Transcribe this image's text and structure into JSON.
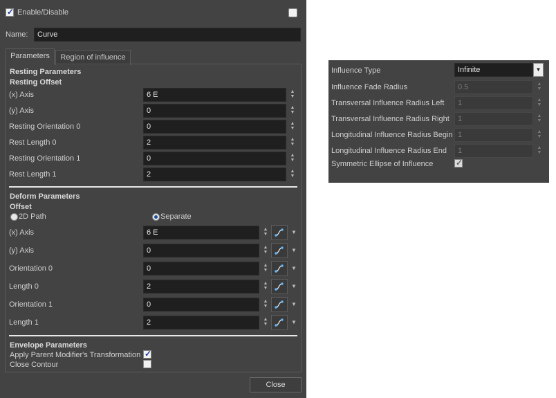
{
  "dialog": {
    "enable_label": "Enable/Disable",
    "enable_checked": true,
    "name_label": "Name:",
    "name_value": "Curve",
    "tabs": [
      {
        "label": "Parameters",
        "active": true
      },
      {
        "label": "Region of influence",
        "active": false
      }
    ],
    "resting": {
      "section_title": "Resting Parameters",
      "subsection_title": "Resting Offset",
      "rows": [
        {
          "label": "(x) Axis",
          "value": "6 E"
        },
        {
          "label": "(y) Axis",
          "value": "0"
        },
        {
          "label": "Resting Orientation 0",
          "value": "0"
        },
        {
          "label": "Rest Length 0",
          "value": "2"
        },
        {
          "label": "Resting Orientation 1",
          "value": "0"
        },
        {
          "label": "Rest Length 1",
          "value": "2"
        }
      ]
    },
    "deform": {
      "section_title": "Deform Parameters",
      "subsection_title": "Offset",
      "radio_2d_path": "2D Path",
      "radio_separate": "Separate",
      "selected_radio": "Separate",
      "rows": [
        {
          "label": "(x) Axis",
          "value": "6 E"
        },
        {
          "label": "(y) Axis",
          "value": "0"
        },
        {
          "label": "Orientation 0",
          "value": "0"
        },
        {
          "label": "Length 0",
          "value": "2"
        },
        {
          "label": "Orientation 1",
          "value": "0"
        },
        {
          "label": "Length 1",
          "value": "2"
        }
      ]
    },
    "envelope": {
      "section_title": "Envelope Parameters",
      "apply_parent_label": "Apply Parent Modifier's Transformation",
      "apply_parent_checked": true,
      "close_contour_label": "Close Contour",
      "close_contour_checked": false
    },
    "close_button": "Close"
  },
  "influence": {
    "rows": [
      {
        "label": "Influence Type",
        "value": "Infinite",
        "kind": "dropdown"
      },
      {
        "label": "Influence Fade Radius",
        "value": "0.5",
        "kind": "spin"
      },
      {
        "label": "Transversal Influence Radius Left",
        "value": "1",
        "kind": "spin"
      },
      {
        "label": "Transversal Influence Radius Right",
        "value": "1",
        "kind": "spin"
      },
      {
        "label": "Longitudinal Influence Radius Begin",
        "value": "1",
        "kind": "spin"
      },
      {
        "label": "Longitudinal Influence Radius End",
        "value": "1",
        "kind": "spin"
      }
    ],
    "symmetric_label": "Symmetric Ellipse of Influence",
    "symmetric_checked": true
  },
  "icons": {
    "spin_arrows": "updown-arrows-icon",
    "function_curve": "function-curve-icon",
    "dropdown": "chevron-down-icon",
    "check": "checkmark-icon"
  },
  "colors": {
    "dialog_bg": "#434343",
    "field_bg": "#1f1f1f",
    "accent_check": "#1c3f9a"
  }
}
